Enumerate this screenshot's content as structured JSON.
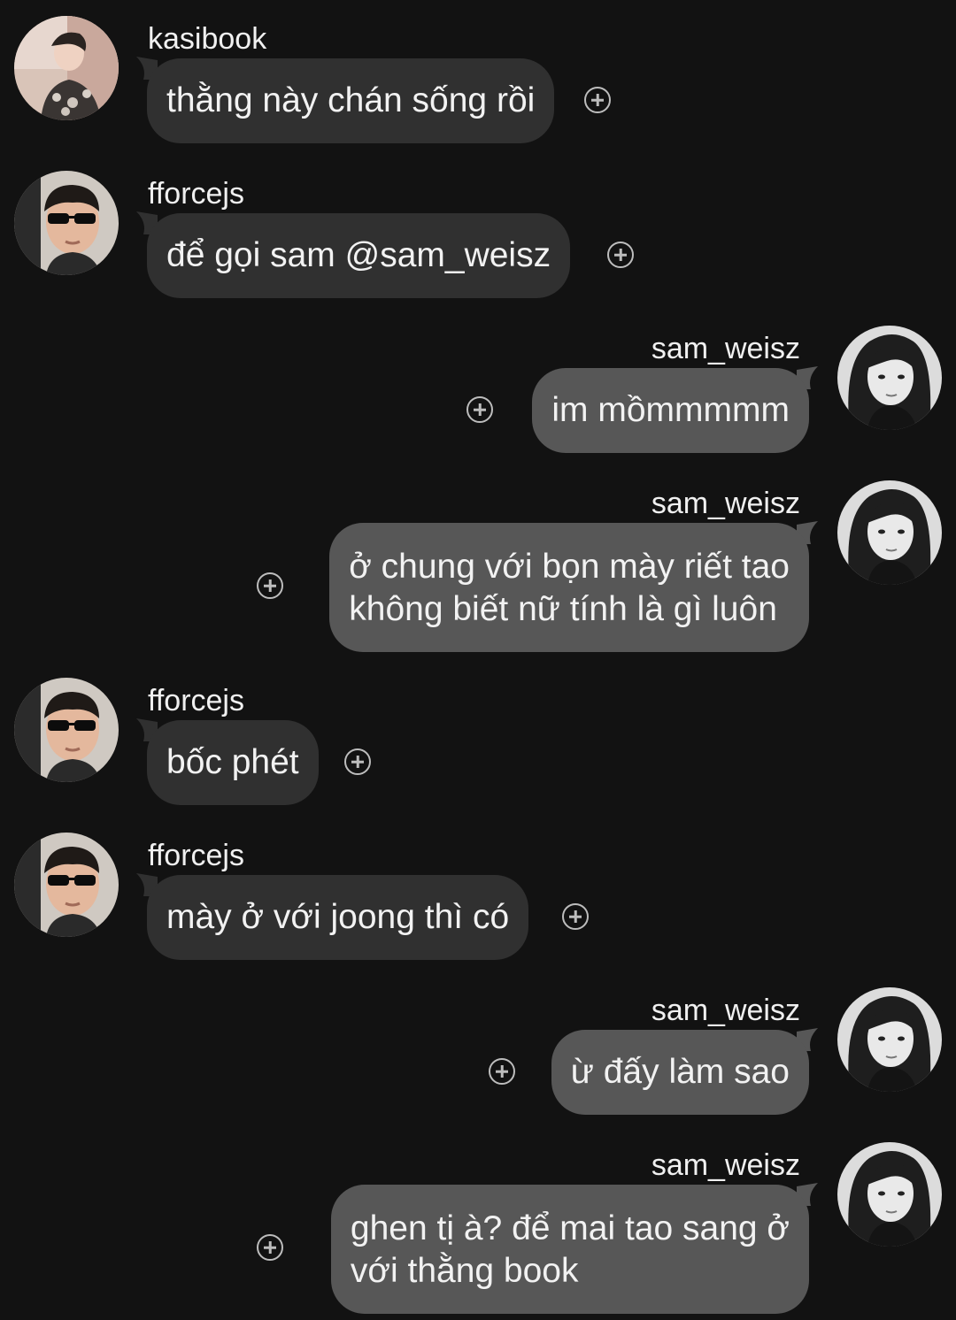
{
  "conversation": {
    "messages": [
      {
        "sender": "kasibook",
        "side": "left",
        "lines": [
          "thằng này chán sống rồi"
        ]
      },
      {
        "sender": "fforcejs",
        "side": "left",
        "lines": [
          "để gọi sam @sam_weisz"
        ]
      },
      {
        "sender": "sam_weisz",
        "side": "right",
        "lines": [
          "im mồmmmmm"
        ]
      },
      {
        "sender": "sam_weisz",
        "side": "right",
        "lines": [
          "ở chung với bọn mày riết tao",
          "không biết nữ tính là gì luôn"
        ]
      },
      {
        "sender": "fforcejs",
        "side": "left",
        "lines": [
          "bốc phét"
        ]
      },
      {
        "sender": "fforcejs",
        "side": "left",
        "lines": [
          "mày ở với joong thì có"
        ]
      },
      {
        "sender": "sam_weisz",
        "side": "right",
        "lines": [
          "ừ đấy làm sao"
        ]
      },
      {
        "sender": "sam_weisz",
        "side": "right",
        "lines": [
          "ghen tị à? để mai tao sang ở",
          "với thằng book"
        ]
      }
    ]
  },
  "icons": {
    "reaction": "add-reaction-icon",
    "avatar": "user-avatar"
  },
  "colors": {
    "background": "#121212",
    "incoming_bubble": "#303030",
    "outgoing_bubble": "#575757",
    "text": "#f2f2f2"
  }
}
